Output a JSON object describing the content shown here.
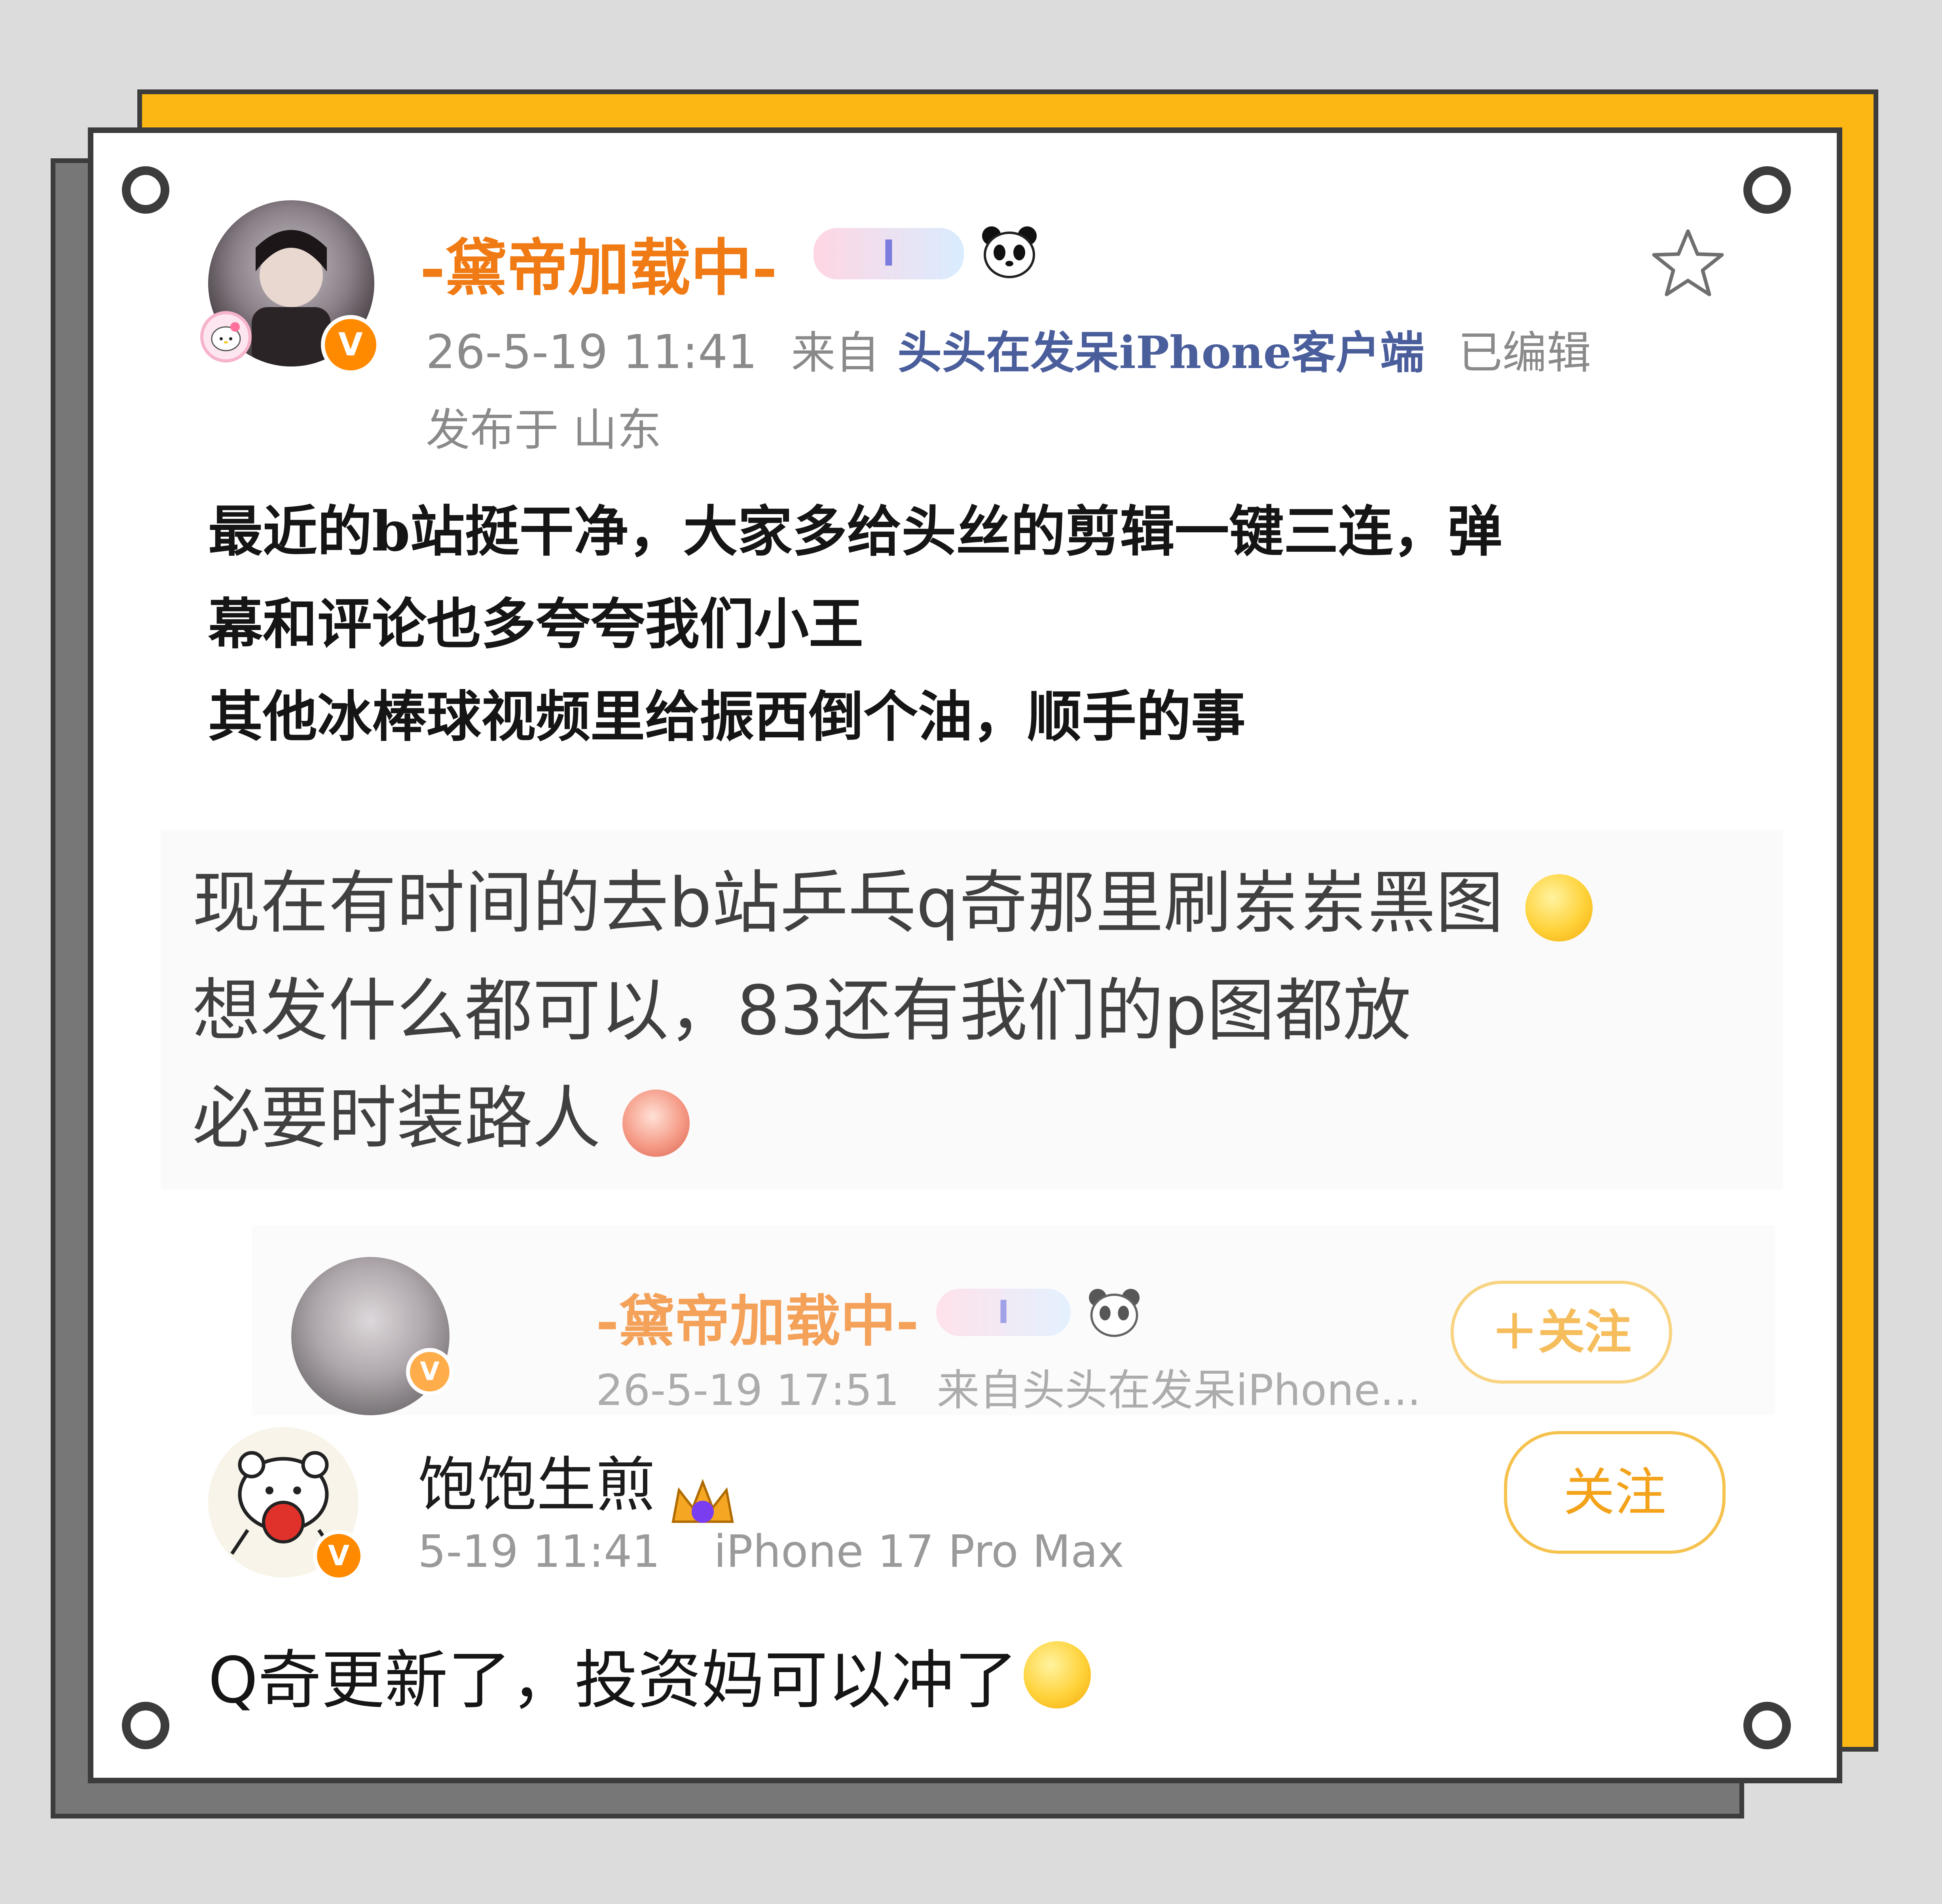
{
  "post": {
    "author": "-黛帝加载中-",
    "timestamp": "26-5-19 11:41",
    "source_prefix": "来自",
    "source": "头头在发呆iPhone客户端",
    "edited": "已编辑",
    "location": "发布于 山东",
    "body": [
      "最近的b站挺干净，大家多给头丝的剪辑一键三连，弹",
      "幕和评论也多夸夸我们小王",
      "其他冰棒球视频里给振西倒个油，顺手的事"
    ],
    "badge_text": "I",
    "verified_mark": "V"
  },
  "screenshot_text": {
    "lines": [
      "现在有时间的去b站乒乓q奇那里刷岽岽黑图",
      "想发什么都可以，83还有我们的p图都放",
      "必要时装路人"
    ]
  },
  "repost_card": {
    "author": "-黛帝加载中-",
    "timestamp": "26-5-19 17:51",
    "source": "来自头头在发呆iPhone...",
    "follow_label": "＋关注",
    "badge_text": "I",
    "verified_mark": "V"
  },
  "comment": {
    "author": "饱饱生煎",
    "timestamp": "5-19 11:41",
    "device": "iPhone 17 Pro Max",
    "follow_label": "关注",
    "body": "Q奇更新了，投资妈可以冲了",
    "verified_mark": "V"
  },
  "icons": [
    "star-icon",
    "panda-icon",
    "verified-badge-icon",
    "smile-emoji-icon",
    "peach-emoji-icon",
    "crown-badge-icon",
    "hello-kitty-icon"
  ],
  "colors": {
    "accent_orange": "#f07a14",
    "frame_yellow": "#fdb714",
    "frame_gray": "#777777",
    "link_blue": "#4a5e9c",
    "follow_gold": "#f3a21a"
  }
}
